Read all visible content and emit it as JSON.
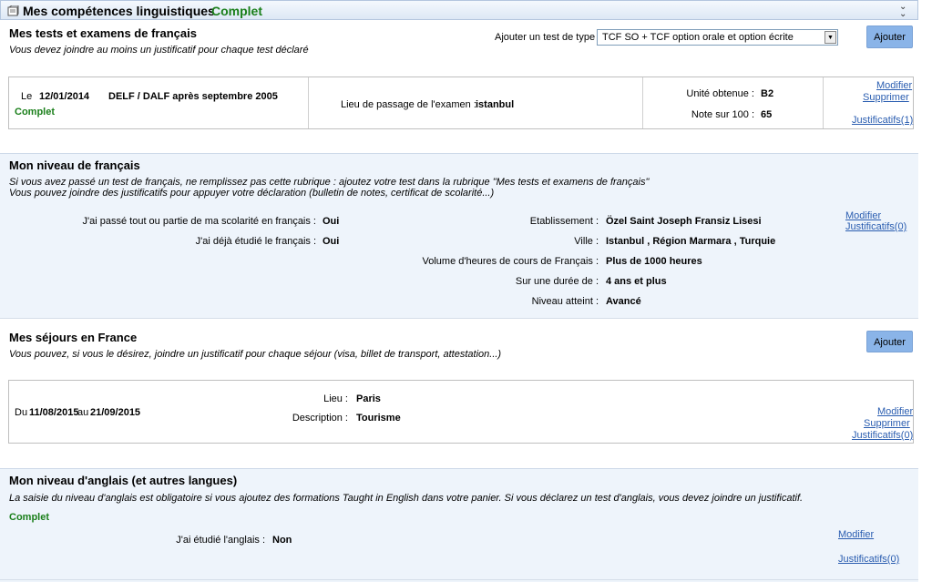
{
  "header": {
    "title": "Mes compétences linguistiques",
    "status": "Complet",
    "book_icon": "book-icon",
    "collapse_icon": "double-chevron-down-icon"
  },
  "tests": {
    "title": "Mes tests et examens de français",
    "subtitle": "Vous devez joindre au moins un justificatif pour chaque test déclaré",
    "add_label": "Ajouter un test de type :",
    "select_value": "TCF SO + TCF option orale et option écrite",
    "add_button": "Ajouter",
    "entry": {
      "prefix": "Le",
      "date": "12/01/2014",
      "exam": "DELF / DALF après septembre 2005",
      "status": "Complet",
      "place_label": "Lieu de passage de l'examen :",
      "place_value": "istanbul",
      "unit_label": "Unité obtenue :",
      "unit_value": "B2",
      "score_label": "Note sur 100 :",
      "score_value": "65",
      "modify": "Modifier",
      "delete": "Supprimer",
      "proofs": "Justificatifs(1)"
    }
  },
  "french_level": {
    "title": "Mon niveau de français",
    "line1": "Si vous avez passé un test de français, ne remplissez pas cette rubrique : ajoutez votre test dans la rubrique \"Mes tests et examens de français\"",
    "line2": "Vous pouvez joindre des justificatifs pour appuyer votre déclaration (bulletin de notes, certificat de scolarité...)",
    "q1_label": "J'ai passé tout ou partie de ma scolarité en français :",
    "q1_value": "Oui",
    "q2_label": "J'ai déjà étudié le français :",
    "q2_value": "Oui",
    "school_label": "Etablissement :",
    "school_value": "Özel Saint Joseph Fransiz Lisesi",
    "city_label": "Ville :",
    "city_value": "Istanbul , Région Marmara , Turquie",
    "hours_label": "Volume d'heures de cours de Français :",
    "hours_value": "Plus de 1000 heures",
    "duration_label": "Sur une durée de :",
    "duration_value": "4 ans et plus",
    "level_label": "Niveau atteint :",
    "level_value": "Avancé",
    "modify": "Modifier",
    "proofs": "Justificatifs(0)"
  },
  "stays": {
    "title": "Mes séjours en France",
    "subtitle": "Vous pouvez, si vous le désirez, joindre un justificatif pour chaque séjour (visa, billet de transport, attestation...)",
    "add_button": "Ajouter",
    "entry": {
      "from": "Du",
      "start": "11/08/2015",
      "to": "au",
      "end": "21/09/2015",
      "place_label": "Lieu :",
      "place_value": "Paris",
      "desc_label": "Description :",
      "desc_value": "Tourisme",
      "modify": "Modifier",
      "delete": "Supprimer",
      "proofs": "Justificatifs(0)"
    }
  },
  "english": {
    "title": "Mon niveau d'anglais (et autres langues)",
    "subtitle": "La saisie du niveau d'anglais est obligatoire si vous ajoutez des formations Taught in English dans votre panier. Si vous déclarez un test d'anglais, vous devez joindre un justificatif.",
    "status": "Complet",
    "q_label": "J'ai étudié l'anglais :",
    "q_value": "Non",
    "modify": "Modifier",
    "proofs": "Justificatifs(0)"
  }
}
